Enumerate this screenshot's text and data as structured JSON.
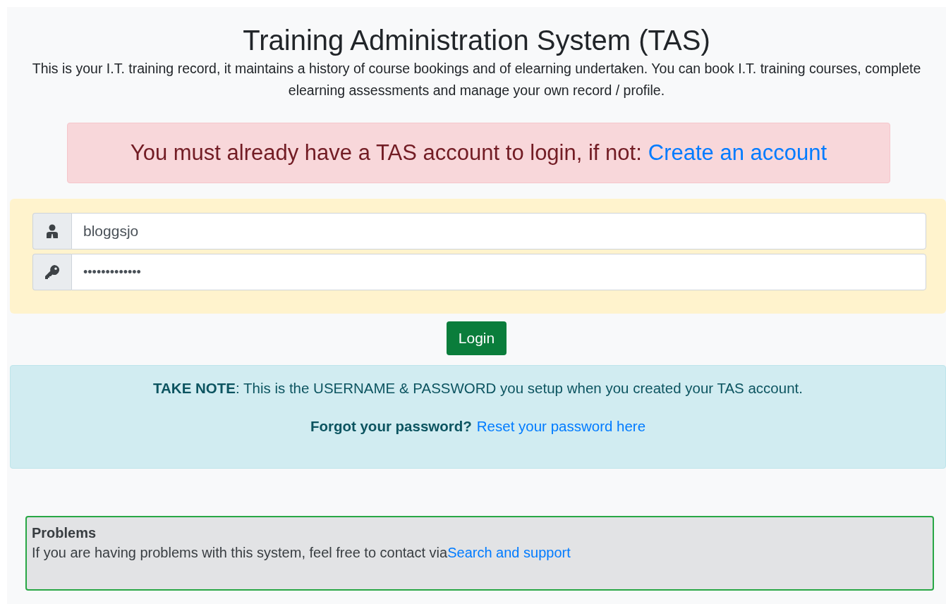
{
  "title": "Training Administration System (TAS)",
  "intro": "This is your I.T. training record, it maintains a history of course bookings and of elearning undertaken. You can book I.T. training courses, complete elearning assessments and manage your own record / profile.",
  "alert": {
    "text": "You must already have a TAS account to login, if not:",
    "link": "Create an account"
  },
  "username": {
    "value": "bloggsjo"
  },
  "password": {
    "value": "•••••••••••••"
  },
  "login_button": "Login",
  "note": {
    "text": "**TAKE NOTE**: This is the USERNAME & PASSWORD you setup when you created your TAS account."
  },
  "forgot": {
    "label": "Forgot your password?",
    "link": "Reset your password here"
  },
  "problems": {
    "title": "Problems",
    "text": "If you are having problems with this system, feel free to contact via",
    "link": "Search and support"
  }
}
